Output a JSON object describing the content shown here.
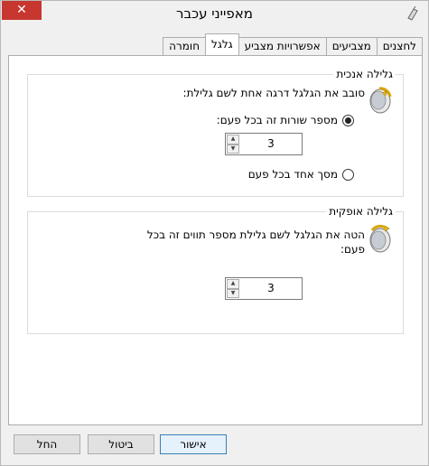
{
  "window": {
    "title": "מאפייני עכבר",
    "close_symbol": "✕"
  },
  "tabs": [
    {
      "label": "לחצנים",
      "active": false
    },
    {
      "label": "מצביעים",
      "active": false
    },
    {
      "label": "אפשרויות מצביע",
      "active": false
    },
    {
      "label": "גלגל",
      "active": true
    },
    {
      "label": "חומרה",
      "active": false
    }
  ],
  "vertical_scrolling": {
    "title": "גלילה אנכית",
    "description": "סובב את הגלגל דרגה אחת לשם גלילת:",
    "option_lines_label": "מספר שורות זה בכל פעם:",
    "option_lines_selected": true,
    "lines_value": "3",
    "option_screen_label": "מסך אחד בכל פעם",
    "option_screen_selected": false
  },
  "horizontal_scrolling": {
    "title": "גלילה אופקית",
    "description_line1": "הטה את הגלגל לשם גלילת מספר תווים זה בכל",
    "description_line2": "פעם:",
    "chars_value": "3"
  },
  "buttons": {
    "ok": "אישור",
    "cancel": "ביטול",
    "apply": "החל"
  },
  "icons": {
    "window_icon": "mouse-icon",
    "wheel_icon": "mouse-wheel-icon",
    "spin_up": "▲",
    "spin_down": "▼"
  }
}
